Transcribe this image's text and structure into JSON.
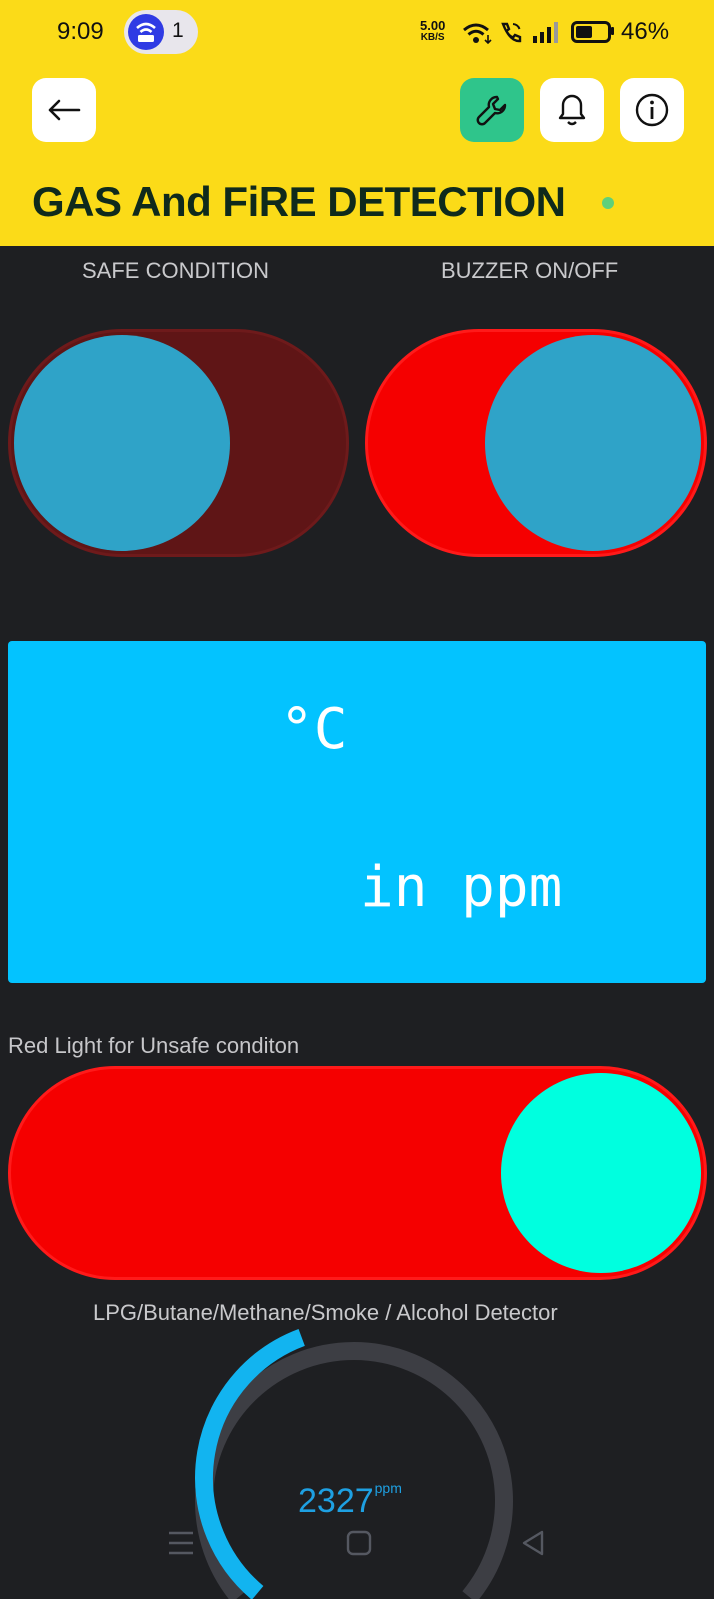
{
  "status_bar": {
    "time": "9:09",
    "notification_count": "1",
    "speed_value": "5.00",
    "speed_unit": "KB/S",
    "battery": "46%"
  },
  "header": {
    "title": "GAS And FiRE DETECTION",
    "icons": [
      "back-arrow-icon",
      "wrench-icon",
      "bell-icon",
      "info-icon"
    ]
  },
  "switches": {
    "safe": {
      "label": "SAFE CONDITION",
      "state": "off"
    },
    "buzzer": {
      "label": "BUZZER ON/OFF",
      "state": "on"
    },
    "red_light": {
      "label": "Red Light for Unsafe conditon",
      "state": "on"
    }
  },
  "lcd": {
    "line1": "°C",
    "line2": "in ppm",
    "color": "#03c3ff"
  },
  "gauge": {
    "label": "LPG/Butane/Methane/Smoke / Alcohol Detector",
    "value": "2327",
    "unit": "ppm",
    "level_fraction": 0.46
  },
  "colors": {
    "header": "#fbdb18",
    "background": "#1e1f22",
    "switch_on": "#f50000",
    "switch_off": "#5f1516",
    "knob": "#2fa3c8",
    "knob_alt": "#00ffdf",
    "gauge_fill": "#12b4f0"
  }
}
